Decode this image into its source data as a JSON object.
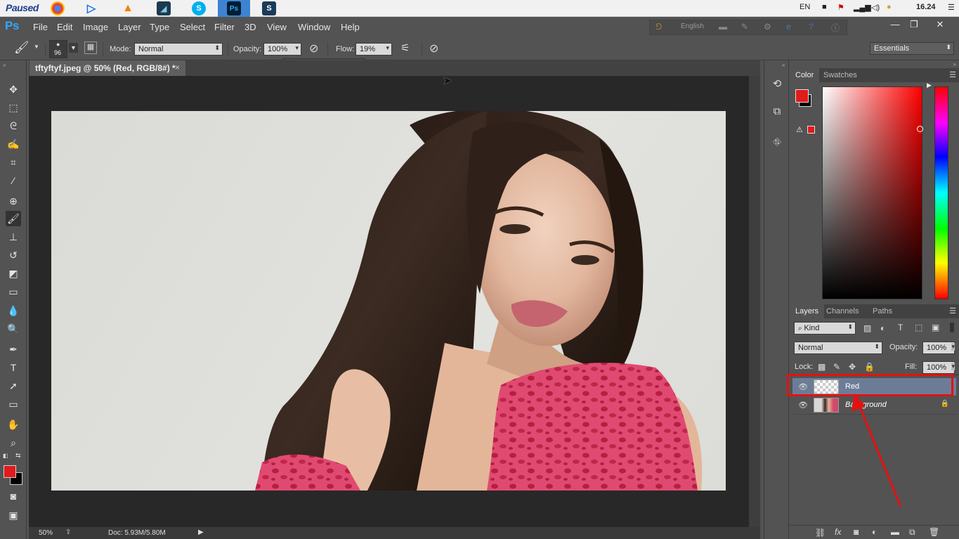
{
  "taskbar": {
    "paused_label": "Paused",
    "apps": [
      "chrome-icon",
      "play-icon",
      "vlc-icon",
      "app-icon",
      "skype-icon",
      "photoshop-icon",
      "s-app-icon"
    ],
    "lang": "EN",
    "time": "16.24"
  },
  "menubar": {
    "logo": "Ps",
    "items": [
      "File",
      "Edit",
      "Image",
      "Layer",
      "Type",
      "Select",
      "Filter",
      "3D",
      "View",
      "Window",
      "Help"
    ],
    "ime_label": "English"
  },
  "options": {
    "brush_size": "96",
    "mode_label": "Mode:",
    "mode_value": "Normal",
    "opacity_label": "Opacity:",
    "opacity_value": "100%",
    "flow_label": "Flow:",
    "flow_value": "19%",
    "workspace": "Essentials"
  },
  "document": {
    "tab_title": "tftyftyf.jpeg @ 50% (Red, RGB/8#) *",
    "zoom": "50%",
    "doc_size": "Doc: 5.93M/5.80M"
  },
  "color_panel": {
    "tabs": [
      "Color",
      "Swatches"
    ],
    "foreground": "#e01b1b",
    "background": "#000000"
  },
  "layers_panel": {
    "tabs": [
      "Layers",
      "Channels",
      "Paths"
    ],
    "filter_kind": "Kind",
    "blend_mode": "Normal",
    "opacity_label": "Opacity:",
    "opacity_value": "100%",
    "lock_label": "Lock:",
    "fill_label": "Fill:",
    "fill_value": "100%",
    "layers": [
      {
        "name": "Red",
        "selected": true
      },
      {
        "name": "Background",
        "selected": false
      }
    ]
  },
  "annotation": {
    "highlight_color": "#e31212"
  }
}
